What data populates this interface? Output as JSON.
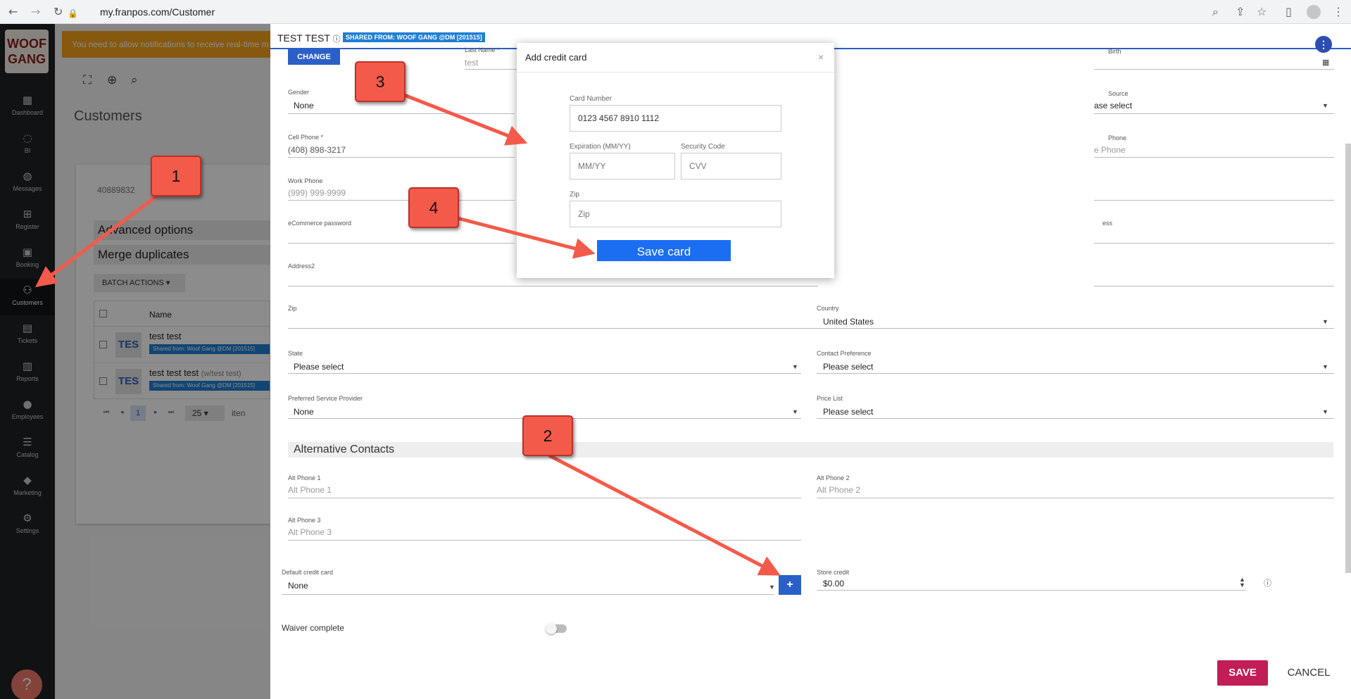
{
  "browser": {
    "url": "my.franpos.com/Customer",
    "icons": [
      "back-icon",
      "forward-icon",
      "reload-icon",
      "lock-icon",
      "zoom-icon",
      "share-icon",
      "star-icon",
      "sidepanel-icon",
      "profile-icon",
      "menu-icon"
    ]
  },
  "sidebar": {
    "logo": "WOOF GANG",
    "items": [
      {
        "label": "Dashboard",
        "icon": "dashboard-icon"
      },
      {
        "label": "BI",
        "icon": "lightbulb-icon"
      },
      {
        "label": "Messages",
        "icon": "chat-icon"
      },
      {
        "label": "Register",
        "icon": "cart-icon"
      },
      {
        "label": "Booking",
        "icon": "calendar-icon"
      },
      {
        "label": "Customers",
        "icon": "people-icon"
      },
      {
        "label": "Tickets",
        "icon": "ticket-icon"
      },
      {
        "label": "Reports",
        "icon": "bar-chart-icon"
      },
      {
        "label": "Employees",
        "icon": "person-icon"
      },
      {
        "label": "Catalog",
        "icon": "list-icon"
      },
      {
        "label": "Marketing",
        "icon": "tag-icon"
      },
      {
        "label": "Settings",
        "icon": "gear-icon"
      }
    ],
    "active": "Customers",
    "help": "?"
  },
  "background": {
    "notification": "You need to allow notifications to receive real-time m",
    "title": "Customers",
    "search_value": "40889832",
    "advanced_options": "Advanced options",
    "merge_duplicates": "Merge duplicates",
    "batch_actions": "BATCH ACTIONS",
    "table": {
      "name_header": "Name",
      "rows": [
        {
          "avatar": "TES",
          "name": "test test",
          "alias": "",
          "tag": "Shared from: Woof Gang @DM [201515]"
        },
        {
          "avatar": "TES",
          "name": "test test test",
          "alias": "(w/test test)",
          "tag": "Shared from: Woof Gang @DM [201515]"
        }
      ]
    },
    "pager": {
      "page": "1",
      "page_size": "25",
      "items_label": "iten"
    }
  },
  "panel": {
    "title": "TEST TEST",
    "shared_badge": "SHARED FROM: WOOF GANG @DM [201515]",
    "change_button": "CHANGE",
    "fields": {
      "last_name": {
        "label": "Last Name *",
        "value": "test"
      },
      "birth": {
        "label": "Birth",
        "value": ""
      },
      "gender": {
        "label": "Gender",
        "value": "None"
      },
      "source": {
        "label": "Source",
        "value": "ase select"
      },
      "cell_phone": {
        "label": "Cell Phone *",
        "value": "(408) 898-3217"
      },
      "home_phone": {
        "label": "Phone",
        "placeholder": "e Phone"
      },
      "work_phone": {
        "label": "Work Phone",
        "placeholder": "(999) 999-9999"
      },
      "ecommerce_password": {
        "label": "eCommerce password",
        "value": ""
      },
      "email": {
        "label": "ess",
        "value": ""
      },
      "address2": {
        "label": "Address2",
        "value": ""
      },
      "zip": {
        "label": "Zip",
        "value": ""
      },
      "country": {
        "label": "Country",
        "value": "United States"
      },
      "state": {
        "label": "State",
        "value": "Please select"
      },
      "contact_preference": {
        "label": "Contact Preference",
        "value": "Please select"
      },
      "preferred_provider": {
        "label": "Preferred Service Provider",
        "value": "None"
      },
      "price_list": {
        "label": "Price List",
        "value": "Please select"
      }
    },
    "alt_contacts": {
      "heading": "Alternative Contacts",
      "alt1": {
        "label": "Alt Phone 1",
        "placeholder": "Alt Phone 1"
      },
      "alt2": {
        "label": "Alt Phone 2",
        "placeholder": "Alt Phone 2"
      },
      "alt3": {
        "label": "Alt Phone 3",
        "placeholder": "Alt Phone 3"
      }
    },
    "default_card": {
      "label": "Default credit card",
      "value": "None",
      "add": "+"
    },
    "store_credit": {
      "label": "Store credit",
      "value": "$0.00"
    },
    "waiver": {
      "label": "Waiver complete",
      "on": false
    },
    "save": "SAVE",
    "cancel": "CANCEL"
  },
  "modal": {
    "title": "Add credit card",
    "close": "×",
    "card_number": {
      "label": "Card Number",
      "value": "0123 4567 8910 1112"
    },
    "expiration": {
      "label": "Expiration (MM/YY)",
      "placeholder": "MM/YY"
    },
    "security": {
      "label": "Security Code",
      "placeholder": "CVV"
    },
    "zip": {
      "label": "Zip",
      "placeholder": "Zip"
    },
    "save_button": "Save card"
  },
  "callouts": [
    "1",
    "2",
    "3",
    "4"
  ],
  "colors": {
    "accent": "#2a5fc7",
    "save": "#c21d57",
    "save_card": "#1b6ef2",
    "callout": "#f45a4a",
    "sidebar": "#1e2226",
    "notification": "#f4a21c",
    "badge": "#1f7fd4"
  }
}
